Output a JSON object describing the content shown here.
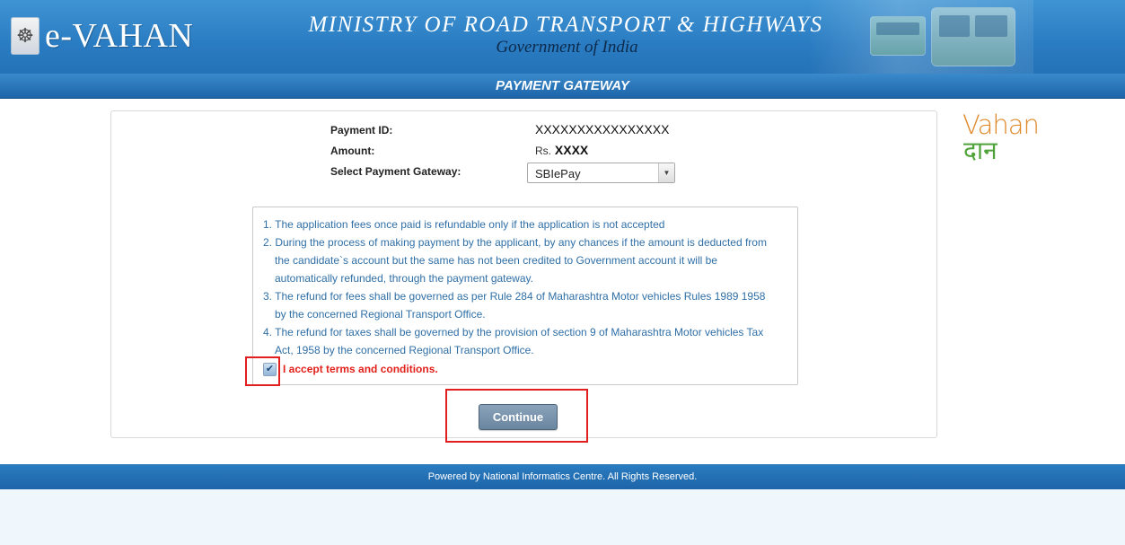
{
  "header": {
    "emblem_icon": "emblem-icon",
    "logo_text": "e-VAHAN",
    "ministry_title": "MINISTRY OF ROAD TRANSPORT & HIGHWAYS",
    "ministry_subtitle": "Government of India"
  },
  "titlebar": {
    "title": "PAYMENT GATEWAY"
  },
  "payment": {
    "id_label": "Payment ID:",
    "id_value": "XXXXXXXXXXXXXXXX",
    "amount_label": "Amount:",
    "amount_prefix": "Rs.",
    "amount_value": "XXXX",
    "gateway_label": "Select Payment Gateway:",
    "gateway_selected": "SBIePay"
  },
  "terms": {
    "items": [
      "1. The application fees once paid is refundable only if the application is not accepted",
      "2. During the process of making payment by the applicant, by any chances if the amount is deducted from",
      "the candidate`s account but the same has not been credited to Government account it will be",
      "automatically refunded, through the payment gateway.",
      "3. The refund for fees shall be governed as per Rule 284 of Maharashtra Motor vehicles Rules 1989 1958",
      "by the concerned Regional Transport Office.",
      "4. The refund for taxes shall be governed by the provision of section 9 of Maharashtra Motor vehicles Tax",
      "Act, 1958 by the concerned Regional Transport Office."
    ],
    "accept_label": "I accept terms and conditions.",
    "accepted": true
  },
  "actions": {
    "continue_label": "Continue"
  },
  "side_logo": {
    "line1": "Vahan",
    "line2": "दान"
  },
  "footer": {
    "text": "Powered by National Informatics Centre. All Rights Reserved."
  },
  "colors": {
    "header_blue": "#2a7cc2",
    "terms_text": "#2f6fa6",
    "accept_red": "#e3211b",
    "highlight_red": "#e11f1f",
    "button_slate": "#6a859f"
  }
}
